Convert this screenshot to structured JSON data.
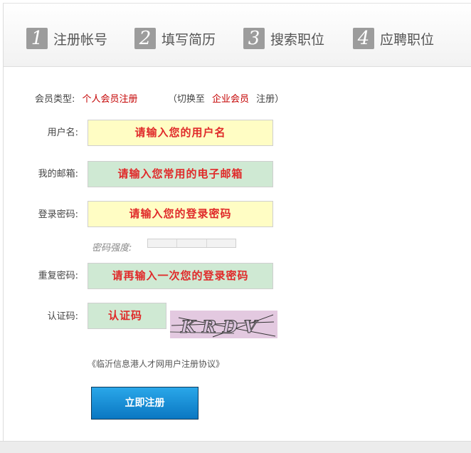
{
  "steps": [
    {
      "num": "1",
      "label": "注册帐号"
    },
    {
      "num": "2",
      "label": "填写简历"
    },
    {
      "num": "3",
      "label": "搜索职位"
    },
    {
      "num": "4",
      "label": "应聘职位"
    }
  ],
  "member_type": {
    "label": "会员类型:",
    "current": "个人会员注册",
    "switch_prefix": "（切换至",
    "switch_link": "企业会员",
    "switch_suffix": "注册）"
  },
  "form": {
    "username_label": "用户名:",
    "username_placeholder": "请输入您的用户名",
    "email_label": "我的邮箱:",
    "email_placeholder": "请输入您常用的电子邮箱",
    "password_label": "登录密码:",
    "password_placeholder": "请输入您的登录密码",
    "strength_label": "密码强度:",
    "repeat_label": "重复密码:",
    "repeat_placeholder": "请再输入一次您的登录密码",
    "captcha_label": "认证码:",
    "captcha_placeholder": "认证码",
    "captcha_text": "KRDV"
  },
  "agreement": "《临沂信息港人才网用户注册协议》",
  "submit_label": "立即注册",
  "colors": {
    "accent_red": "#c40000",
    "placeholder_red": "#e02a2a",
    "input_yellow": "#fffdc4",
    "input_green": "#cfe9d3",
    "button_blue": "#0a77c2"
  }
}
